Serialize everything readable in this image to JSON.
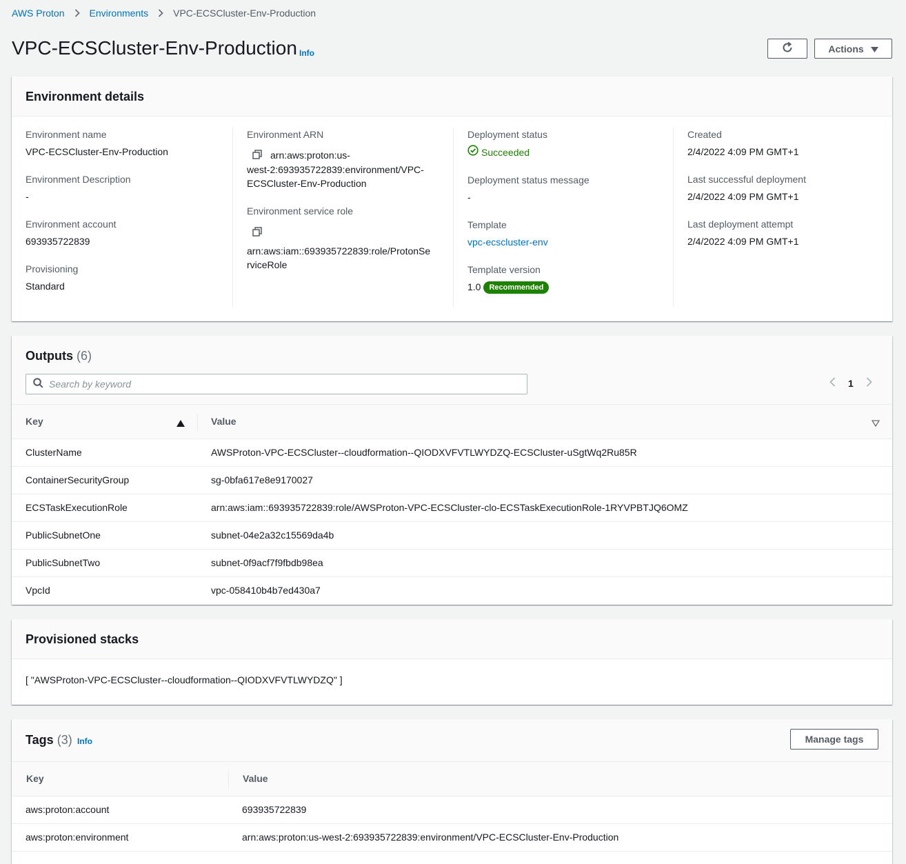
{
  "breadcrumb": {
    "items": [
      "AWS Proton",
      "Environments",
      "VPC-ECSCluster-Env-Production"
    ]
  },
  "page": {
    "title": "VPC-ECSCluster-Env-Production",
    "info": "Info",
    "actions_label": "Actions"
  },
  "details": {
    "title": "Environment details",
    "col1": {
      "env_name_label": "Environment name",
      "env_name": "VPC-ECSCluster-Env-Production",
      "desc_label": "Environment Description",
      "desc": "-",
      "account_label": "Environment account",
      "account": "693935722839",
      "provisioning_label": "Provisioning",
      "provisioning": "Standard"
    },
    "col2": {
      "arn_label": "Environment ARN",
      "arn_line1": "arn:aws:proton:us-",
      "arn_line2": "west-2:693935722839:environment/VPC-",
      "arn_line3": "ECSCluster-Env-Production",
      "role_label": "Environment service role",
      "role_line1": "arn:aws:iam::693935722839:role/ProtonSe",
      "role_line2": "rviceRole"
    },
    "col3": {
      "status_label": "Deployment status",
      "status": "Succeeded",
      "status_msg_label": "Deployment status message",
      "status_msg": "-",
      "template_label": "Template",
      "template": "vpc-ecscluster-env",
      "version_label": "Template version",
      "version": "1.0",
      "version_badge": "Recommended"
    },
    "col4": {
      "created_label": "Created",
      "created": "2/4/2022 4:09 PM GMT+1",
      "last_success_label": "Last successful deployment",
      "last_success": "2/4/2022 4:09 PM GMT+1",
      "last_attempt_label": "Last deployment attempt",
      "last_attempt": "2/4/2022 4:09 PM GMT+1"
    }
  },
  "outputs": {
    "title": "Outputs",
    "count": "(6)",
    "search_placeholder": "Search by keyword",
    "page": "1",
    "col_key": "Key",
    "col_value": "Value",
    "rows": [
      {
        "key": "ClusterName",
        "value": "AWSProton-VPC-ECSCluster--cloudformation--QIODXVFVTLWYDZQ-ECSCluster-uSgtWq2Ru85R"
      },
      {
        "key": "ContainerSecurityGroup",
        "value": "sg-0bfa617e8e9170027"
      },
      {
        "key": "ECSTaskExecutionRole",
        "value": "arn:aws:iam::693935722839:role/AWSProton-VPC-ECSCluster-clo-ECSTaskExecutionRole-1RYVPBTJQ6OMZ"
      },
      {
        "key": "PublicSubnetOne",
        "value": "subnet-04e2a32c15569da4b"
      },
      {
        "key": "PublicSubnetTwo",
        "value": "subnet-0f9acf7f9fbdb98ea"
      },
      {
        "key": "VpcId",
        "value": "vpc-058410b4b7ed430a7"
      }
    ]
  },
  "stacks": {
    "title": "Provisioned stacks",
    "text": "[ \"AWSProton-VPC-ECSCluster--cloudformation--QIODXVFVTLWYDZQ\" ]"
  },
  "tags": {
    "title": "Tags",
    "count": "(3)",
    "info": "Info",
    "manage_label": "Manage tags",
    "col_key": "Key",
    "col_value": "Value",
    "rows": [
      {
        "key": "aws:proton:account",
        "value": "693935722839"
      },
      {
        "key": "aws:proton:environment",
        "value": "arn:aws:proton:us-west-2:693935722839:environment/VPC-ECSCluster-Env-Production"
      }
    ]
  },
  "colors": {
    "link": "#0073bb",
    "success": "#1d8102",
    "background": "#f2f3f3"
  }
}
